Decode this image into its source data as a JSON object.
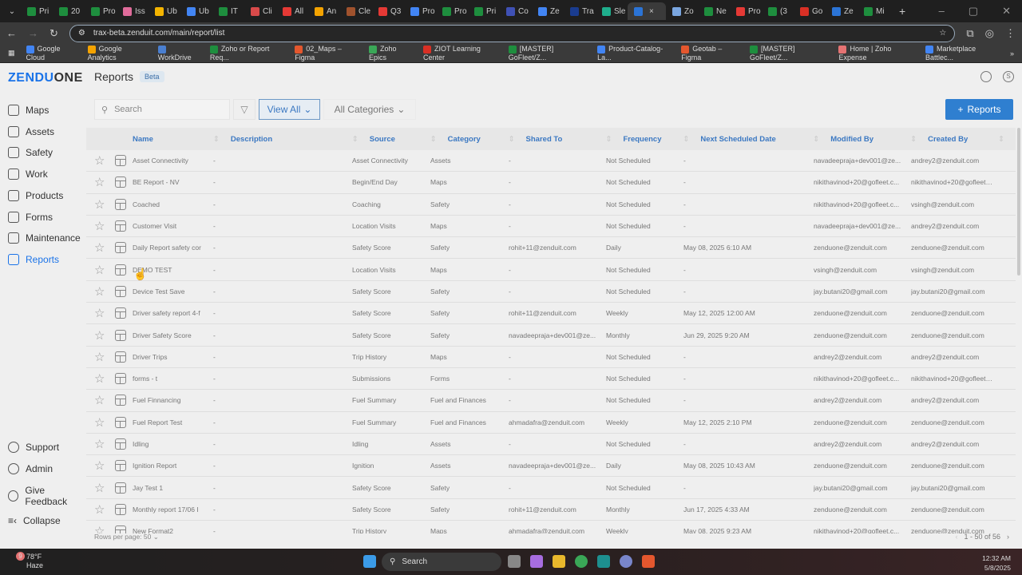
{
  "browser": {
    "tabs": [
      "Pri",
      "20",
      "Pro",
      "Iss",
      "Ub",
      "Ub",
      "IT",
      "Cli",
      "All",
      "An",
      "Cle",
      "Q3",
      "Pro",
      "Pro",
      "Pri",
      "Co",
      "Ze",
      "Tra",
      "Sle",
      "",
      "Zo",
      "Ne",
      "Pro",
      "(3",
      "Go",
      "Ze",
      "Mi"
    ],
    "url": "trax-beta.zenduit.com/main/report/list",
    "bookmarks": [
      "Google Cloud",
      "Google Analytics",
      "WorkDrive",
      "Zoho or Report Req...",
      "02_Maps – Figma",
      "Zoho Epics",
      "ZIOT Learning Center",
      "[MASTER] GoFleet/Z...",
      "Product-Catalog-La...",
      "Geotab – Figma",
      "[MASTER] GoFleet/Z...",
      "Home | Zoho Expense",
      "Marketplace Battlec..."
    ],
    "more": "»"
  },
  "app": {
    "logo_blue": "ZENDU",
    "logo_dark": "ONE",
    "nav": [
      "Maps",
      "Assets",
      "Safety",
      "Work",
      "Products",
      "Forms",
      "Maintenance",
      "Reports"
    ],
    "nav_bottom": [
      "Support",
      "Admin",
      "Give Feedback"
    ],
    "collapse": "Collapse",
    "title": "Reports",
    "badge": "Beta",
    "avatar": "S"
  },
  "toolbar": {
    "search_placeholder": "Search",
    "view": "View All",
    "categories": "All Categories",
    "add": "Reports"
  },
  "columns": [
    "Name",
    "Description",
    "Source",
    "Category",
    "Shared To",
    "Frequency",
    "Next Scheduled Date",
    "Modified By",
    "Created By"
  ],
  "rows": [
    [
      "Asset Connectivity",
      "-",
      "Asset Connectivity",
      "Assets",
      "-",
      "Not Scheduled",
      "-",
      "navadeepraja+dev001@ze...",
      "andrey2@zenduit.com"
    ],
    [
      "BE Report - NV",
      "-",
      "Begin/End Day",
      "Maps",
      "-",
      "Not Scheduled",
      "-",
      "nikithavinod+20@gofleet.c...",
      "nikithavinod+20@gofleet.c..."
    ],
    [
      "Coached",
      "-",
      "Coaching",
      "Safety",
      "-",
      "Not Scheduled",
      "-",
      "nikithavinod+20@gofleet.c...",
      "vsingh@zenduit.com"
    ],
    [
      "Customer Visit",
      "-",
      "Location Visits",
      "Maps",
      "-",
      "Not Scheduled",
      "-",
      "navadeepraja+dev001@ze...",
      "andrey2@zenduit.com"
    ],
    [
      "Daily Report safety cor",
      "-",
      "Safety Score",
      "Safety",
      "rohit+11@zenduit.com",
      "Daily",
      "May 08, 2025 6:10 AM",
      "zenduone@zenduit.com",
      "zenduone@zenduit.com"
    ],
    [
      "DEMO TEST",
      "-",
      "Location Visits",
      "Maps",
      "-",
      "Not Scheduled",
      "-",
      "vsingh@zenduit.com",
      "vsingh@zenduit.com"
    ],
    [
      "Device Test Save",
      "-",
      "Safety Score",
      "Safety",
      "-",
      "Not Scheduled",
      "-",
      "jay.butani20@gmail.com",
      "jay.butani20@gmail.com"
    ],
    [
      "Driver safety report 4-f",
      "-",
      "Safety Score",
      "Safety",
      "rohit+11@zenduit.com",
      "Weekly",
      "May 12, 2025 12:00 AM",
      "zenduone@zenduit.com",
      "zenduone@zenduit.com"
    ],
    [
      "Driver Safety Score",
      "-",
      "Safety Score",
      "Safety",
      "navadeepraja+dev001@ze...",
      "Monthly",
      "Jun 29, 2025 9:20 AM",
      "zenduone@zenduit.com",
      "zenduone@zenduit.com"
    ],
    [
      "Driver Trips",
      "-",
      "Trip History",
      "Maps",
      "-",
      "Not Scheduled",
      "-",
      "andrey2@zenduit.com",
      "andrey2@zenduit.com"
    ],
    [
      "forms - t",
      "-",
      "Submissions",
      "Forms",
      "-",
      "Not Scheduled",
      "-",
      "nikithavinod+20@gofleet.c...",
      "nikithavinod+20@gofleet.c..."
    ],
    [
      "Fuel Finnancing",
      "-",
      "Fuel Summary",
      "Fuel and Finances",
      "-",
      "Not Scheduled",
      "-",
      "andrey2@zenduit.com",
      "andrey2@zenduit.com"
    ],
    [
      "Fuel Report Test",
      "-",
      "Fuel Summary",
      "Fuel and Finances",
      "ahmadafra@zenduit.com",
      "Weekly",
      "May 12, 2025 2:10 PM",
      "zenduone@zenduit.com",
      "zenduone@zenduit.com"
    ],
    [
      "Idling",
      "-",
      "Idling",
      "Assets",
      "-",
      "Not Scheduled",
      "-",
      "andrey2@zenduit.com",
      "andrey2@zenduit.com"
    ],
    [
      "Ignition Report",
      "-",
      "Ignition",
      "Assets",
      "navadeepraja+dev001@ze...",
      "Daily",
      "May 08, 2025 10:43 AM",
      "zenduone@zenduit.com",
      "zenduone@zenduit.com"
    ],
    [
      "Jay Test 1",
      "-",
      "Safety Score",
      "Safety",
      "-",
      "Not Scheduled",
      "-",
      "jay.butani20@gmail.com",
      "jay.butani20@gmail.com"
    ],
    [
      "Monthly report 17/06 I",
      "-",
      "Safety Score",
      "Safety",
      "rohit+11@zenduit.com",
      "Monthly",
      "Jun 17, 2025 4:33 AM",
      "zenduone@zenduit.com",
      "zenduone@zenduit.com"
    ],
    [
      "New Format2",
      "-",
      "Trip History",
      "Maps",
      "ahmadafra@zenduit.com",
      "Weekly",
      "May 08, 2025 9:23 AM",
      "nikithavinod+20@gofleet.c...",
      "zenduone@zenduit.com"
    ]
  ],
  "footer": {
    "rows_label": "Rows per page:",
    "rows_value": "50",
    "range": "1 - 50 of 56"
  },
  "taskbar": {
    "temp": "78°F",
    "weather": "Haze",
    "badge": "9",
    "search": "Search",
    "time": "12:32 AM",
    "date": "5/8/2025"
  },
  "colors": {
    "accent": "#2f7fd0",
    "header_text": "#3b78c2"
  }
}
